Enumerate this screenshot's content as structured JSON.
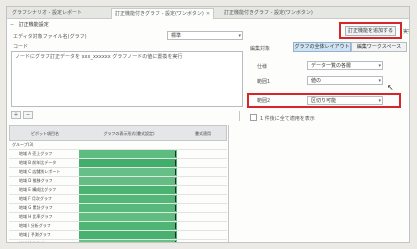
{
  "tabs": [
    {
      "label": "グラフシナリオ - 設定レポート",
      "closable": false,
      "active": false
    },
    {
      "label": "訂正機能付きグラフ - 設定(ワンボタン)",
      "closable": true,
      "active": true
    },
    {
      "label": "訂正機能付きグラフ - 設定(ワンボタン)",
      "closable": false,
      "active": false
    }
  ],
  "close_symbol": "✕",
  "section_title": "訂正機能設定",
  "collapse_symbol": "−",
  "left": {
    "field1_label": "エディタ対象ファイル名(グラフ)",
    "field1_value": "標準",
    "code_label": "コード",
    "code_text": "ノードにグラフ訂正データを xxx_xxxxxx グラフノードの値に置換を実行"
  },
  "toolbar": {
    "add_symbol": "＋",
    "minus_symbol": "−"
  },
  "right": {
    "top_button": "訂正機能を追加する",
    "side_label": "実行",
    "mode_label": "編集対象",
    "seg_active": "グラフの全体レイアウト",
    "seg_inactive": "編集ワークスペース",
    "rows": [
      {
        "label": "仕様",
        "value": "データ一覧の各層"
      },
      {
        "label": "範囲1",
        "value": "値の"
      },
      {
        "label": "範囲2",
        "value": "区切り可能"
      }
    ],
    "checkbox_label": "1 件後に全て適用を表示",
    "dropdown_arrow": "▾"
  },
  "grid": {
    "headers": [
      "ピボット項目名",
      "グラフの表示形式(書式設定)",
      "書式適用"
    ],
    "group_label": "グループ(3)",
    "rows": [
      {
        "name": "地域 A 売上グラフ",
        "level": 0.62
      },
      {
        "name": "地域 B 前年比データ",
        "level": 0.85
      },
      {
        "name": "地域 C 店舗別レポート",
        "level": 0.55
      },
      {
        "name": "地域 D 推移グラフ",
        "level": 0.58
      },
      {
        "name": "地域 E 構成比グラフ",
        "level": 0.78
      },
      {
        "name": "地域 F 月次グラフ",
        "level": 0.7
      },
      {
        "name": "地域 G 累計グラフ",
        "level": 0.66
      },
      {
        "name": "地域 H 比率グラフ",
        "level": 0.6
      },
      {
        "name": "地域 I 分析グラフ",
        "level": 0.74
      },
      {
        "name": "地域 J 予測グラフ",
        "level": 0.8
      },
      {
        "name": "地域 K 集計グラフ",
        "level": 0.52
      }
    ]
  },
  "colors": {
    "highlight": "#d7262a",
    "active_segment": "#cfe3f2",
    "heat_low": "#a8ddb6",
    "heat_high": "#2fa75e"
  }
}
